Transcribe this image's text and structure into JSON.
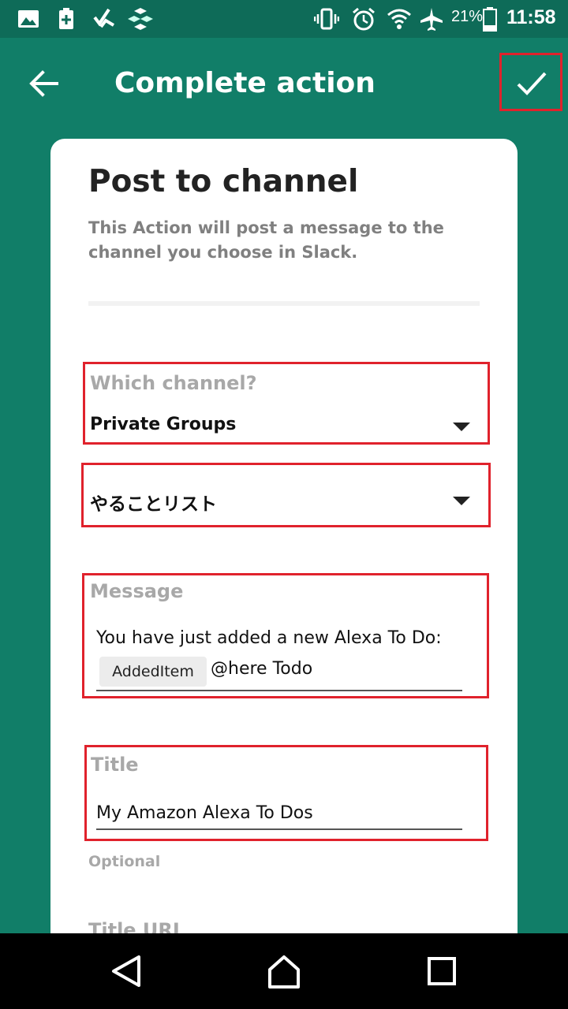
{
  "status_bar": {
    "battery_percent": "21%",
    "time": "11:58"
  },
  "header": {
    "title": "Complete action"
  },
  "card": {
    "title": "Post to channel",
    "description": "This Action will post a message to the channel you choose in Slack.",
    "channel_field": {
      "label": "Which channel?",
      "value": "Private Groups"
    },
    "group_field": {
      "value": "やることリスト"
    },
    "message_field": {
      "label": "Message",
      "line1": "You have just added a new Alexa To Do:",
      "ingredient_chip": "AddedItem",
      "line2_suffix": "@here Todo"
    },
    "title_field": {
      "label": "Title",
      "value": "My Amazon Alexa To Dos",
      "helper": "Optional"
    },
    "title_url_field": {
      "label": "Title URL"
    }
  },
  "colors": {
    "background": "#117e68",
    "status_bar": "#0e6b58",
    "highlight": "#e0222c"
  }
}
